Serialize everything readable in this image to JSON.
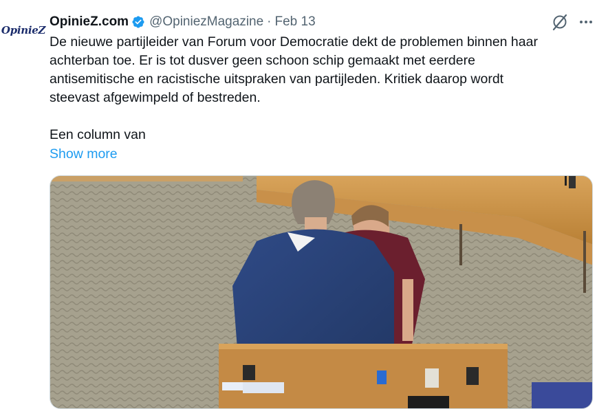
{
  "tweet": {
    "avatar_text": "OpinieZ",
    "author_name": "OpinieZ.com",
    "handle": "@OpiniezMagazine",
    "separator": "·",
    "date": "Feb 13",
    "text_lines": [
      "De nieuwe partijleider van Forum voor Democratie dekt de problemen binnen haar",
      "achterban toe. Er is tot dusver geen schoon schip gemaakt met eerdere",
      "antisemitische en racistische uitspraken van partijleden. Kritiek daarop wordt",
      "steevast afgewimpeld of bestreden."
    ],
    "text_line_2": "Een column van",
    "show_more": "Show more"
  },
  "colors": {
    "verified": "#1d9bf0",
    "link": "#1d9bf0",
    "secondary_text": "#536471"
  },
  "icons": {
    "verified": "verified-badge-icon",
    "grok": "grok-icon",
    "more": "more-options-icon"
  }
}
